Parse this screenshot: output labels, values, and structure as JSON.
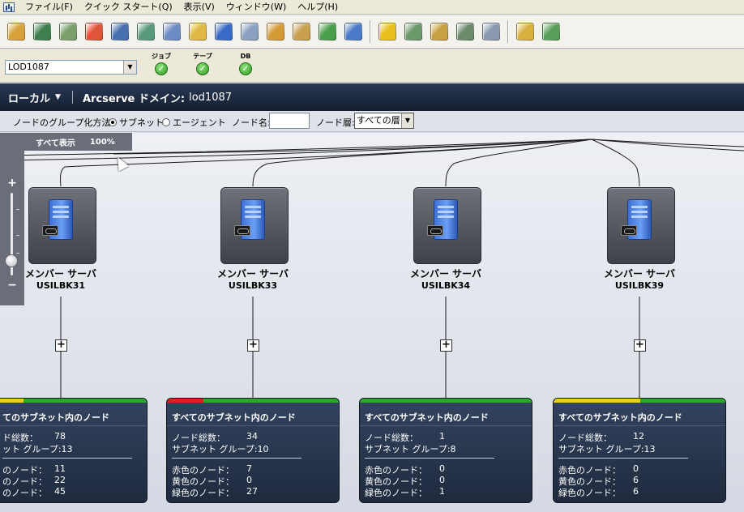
{
  "menu": [
    "ファイル(F)",
    "クイック スタート(Q)",
    "表示(V)",
    "ウィンドウ(W)",
    "ヘルプ(H)"
  ],
  "toolbar": {
    "group1": [
      {
        "icon": "chart-icon",
        "color": "#d8a23a"
      },
      {
        "icon": "backup-icon",
        "color": "#3f7f4e"
      },
      {
        "icon": "restore-icon",
        "color": "#7a9f6a"
      },
      {
        "icon": "pie-report-icon",
        "color": "#e0553a"
      },
      {
        "icon": "network-icon",
        "color": "#4a6fb0"
      },
      {
        "icon": "media-icon",
        "color": "#5a9a7a"
      },
      {
        "icon": "disk-icon",
        "color": "#6c8cc4"
      },
      {
        "icon": "tape-icon",
        "color": "#e0b845"
      },
      {
        "icon": "database-icon",
        "color": "#3a6ac8"
      },
      {
        "icon": "copy-icon",
        "color": "#8aa0c0"
      },
      {
        "icon": "settings-icon",
        "color": "#d49a36"
      },
      {
        "icon": "users-icon",
        "color": "#c8a050"
      },
      {
        "icon": "refresh-icon",
        "color": "#4aa04a"
      },
      {
        "icon": "tools-icon",
        "color": "#4a7ac8"
      }
    ],
    "group2": [
      {
        "icon": "alert-icon",
        "color": "#e8c020"
      },
      {
        "icon": "drive-icon",
        "color": "#6a9a6a"
      },
      {
        "icon": "scale-icon",
        "color": "#c8a040"
      },
      {
        "icon": "calculator-icon",
        "color": "#6a8a6a"
      },
      {
        "icon": "trash-icon",
        "color": "#8a9ab0"
      }
    ],
    "group3": [
      {
        "icon": "archive-icon",
        "color": "#d8b040"
      },
      {
        "icon": "device-icon",
        "color": "#5aa05a"
      }
    ]
  },
  "status": {
    "server": "LOD1087",
    "items": [
      {
        "label": "ジョブ",
        "state": "ok"
      },
      {
        "label": "テープ",
        "state": "ok"
      },
      {
        "label": "DB",
        "state": "ok"
      }
    ]
  },
  "domain": {
    "scope": "ローカル",
    "label": "Arcserve ドメイン:",
    "name": "lod1087"
  },
  "filter": {
    "group_label": "ノードのグループ化方法:",
    "subnet": "サブネット",
    "agent": "エージェント",
    "name_label": "ノード名:",
    "tier_label": "ノード層:",
    "tier_value": "すべての層"
  },
  "view": {
    "show_all": "すべて表示",
    "zoom": "100%",
    "zoom_in": "+",
    "zoom_out": "−"
  },
  "nodes": [
    {
      "type": "メンバー サーバ",
      "host": "USILBK31"
    },
    {
      "type": "メンバー サーバ",
      "host": "USILBK33"
    },
    {
      "type": "メンバー サーバ",
      "host": "USILBK34"
    },
    {
      "type": "メンバー サーバ",
      "host": "USILBK39"
    }
  ],
  "expand_symbol": "+",
  "panels": [
    {
      "title": "てのサブネット内のノード",
      "total_label": "ド総数：",
      "total": "78",
      "groups_label": "ット グループ:13",
      "red_label": "のノード：",
      "red": "11",
      "yellow_label": "のノード：",
      "yellow": "22",
      "green_label": "のノード：",
      "green": "45",
      "bars": [
        {
          "color": "#e8d020",
          "fraction": 0.28
        },
        {
          "color": "#2aa82a",
          "fraction": 0.72
        }
      ]
    },
    {
      "title": "すべてのサブネット内のノード",
      "total_label": "ノード総数：",
      "total": "34",
      "groups_label": "サブネット グループ:10",
      "red_label": "赤色のノード：",
      "red": "7",
      "yellow_label": "黄色のノード：",
      "yellow": "0",
      "green_label": "緑色のノード：",
      "green": "27",
      "bars": [
        {
          "color": "#e02020",
          "fraction": 0.21
        },
        {
          "color": "#2aa82a",
          "fraction": 0.79
        }
      ]
    },
    {
      "title": "すべてのサブネット内のノード",
      "total_label": "ノード総数：",
      "total": "1",
      "groups_label": "サブネット グループ:8",
      "red_label": "赤色のノード：",
      "red": "0",
      "yellow_label": "黄色のノード：",
      "yellow": "0",
      "green_label": "緑色のノード：",
      "green": "1",
      "bars": [
        {
          "color": "#2aa82a",
          "fraction": 1.0
        }
      ]
    },
    {
      "title": "すべてのサブネット内のノード",
      "total_label": "ノード総数：",
      "total": "12",
      "groups_label": "サブネット グループ:13",
      "red_label": "赤色のノード：",
      "red": "0",
      "yellow_label": "黄色のノード：",
      "yellow": "6",
      "green_label": "緑色のノード：",
      "green": "6",
      "bars": [
        {
          "color": "#e8d020",
          "fraction": 0.5
        },
        {
          "color": "#2aa82a",
          "fraction": 0.5
        }
      ]
    }
  ]
}
